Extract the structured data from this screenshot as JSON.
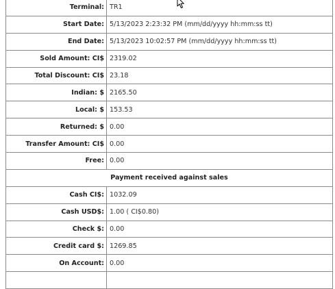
{
  "rows_top": [
    {
      "label": "Terminal:",
      "value": "TR1"
    },
    {
      "label": "Start Date:",
      "value": "5/13/2023 2:23:32 PM (mm/dd/yyyy hh:mm:ss tt)"
    },
    {
      "label": "End Date:",
      "value": "5/13/2023 10:02:57 PM (mm/dd/yyyy hh:mm:ss tt)"
    },
    {
      "label": "Sold Amount: CI$",
      "value": "2319.02"
    },
    {
      "label": "Total Discount: CI$",
      "value": "23.18"
    },
    {
      "label": "Indian: $",
      "value": "2165.50"
    },
    {
      "label": "Local: $",
      "value": "153.53"
    },
    {
      "label": "Returned: $",
      "value": "0.00"
    },
    {
      "label": "Transfer Amount: CI$",
      "value": "0.00"
    },
    {
      "label": "Free:",
      "value": "0.00"
    }
  ],
  "section_header": "Payment received against sales",
  "rows_payment": [
    {
      "label": "Cash CI$:",
      "value": "1032.09"
    },
    {
      "label": "Cash USD$:",
      "value": "1.00 ( CI$0.80)"
    },
    {
      "label": "Check $:",
      "value": "0.00"
    },
    {
      "label": "Credit card $:",
      "value": "1269.85"
    },
    {
      "label": "On Account:",
      "value": "0.00"
    },
    {
      "label": "",
      "value": ""
    }
  ]
}
